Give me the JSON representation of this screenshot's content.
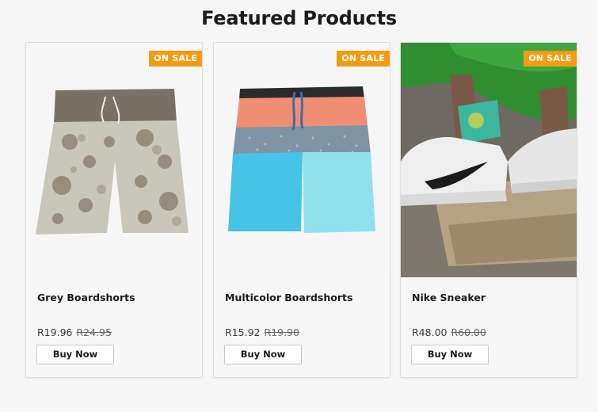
{
  "page": {
    "title": "Featured Products"
  },
  "colors": {
    "badge": "#f39c12",
    "page_background": "#f6f6f6"
  },
  "products": [
    {
      "badge": "ON SALE",
      "name": "Grey Boardshorts",
      "price": "R19.96",
      "old_price": "R24.95",
      "button_label": "Buy Now",
      "image": "grey-floral-boardshorts-image"
    },
    {
      "badge": "ON SALE",
      "name": "Multicolor Boardshorts",
      "price": "R15.92",
      "old_price": "R19.90",
      "button_label": "Buy Now",
      "image": "multicolor-boardshorts-image"
    },
    {
      "badge": "ON SALE",
      "name": "Nike Sneaker",
      "price": "R48.00",
      "old_price": "R60.00",
      "button_label": "Buy Now",
      "image": "nike-sneaker-photo-image"
    }
  ]
}
